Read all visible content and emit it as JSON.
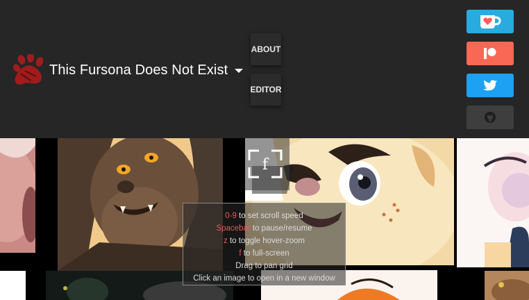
{
  "header": {
    "title": "This Fursona Does Not Exist",
    "nav": {
      "about_label": "ABOUT",
      "editor_label": "EDITOR"
    },
    "social": [
      {
        "name": "ko-fi",
        "icon": "kofi-cup-icon",
        "color": "#29abe0"
      },
      {
        "name": "patreon",
        "icon": "patreon-icon",
        "color": "#f96854"
      },
      {
        "name": "twitter",
        "icon": "twitter-bird-icon",
        "color": "#1da1f2"
      },
      {
        "name": "github",
        "icon": "github-icon",
        "color": "#3e3e3e"
      }
    ]
  },
  "fullscreen_overlay": {
    "key_glyph": "f"
  },
  "help": {
    "lines": [
      {
        "key": "0-9",
        "text": " to set scroll speed"
      },
      {
        "key": "Spacebar",
        "text": " to pause/resume"
      },
      {
        "key": "z",
        "text": " to toggle hover-zoom"
      },
      {
        "key": "f",
        "text": " to full-screen"
      },
      {
        "key": "",
        "text": "Drag to pan grid"
      },
      {
        "key": "",
        "text": "Click an image to open in a new window"
      }
    ]
  },
  "colors": {
    "header_bg": "#262626",
    "accent_red": "#e85a5a",
    "paw_red": "#a01c1c"
  }
}
